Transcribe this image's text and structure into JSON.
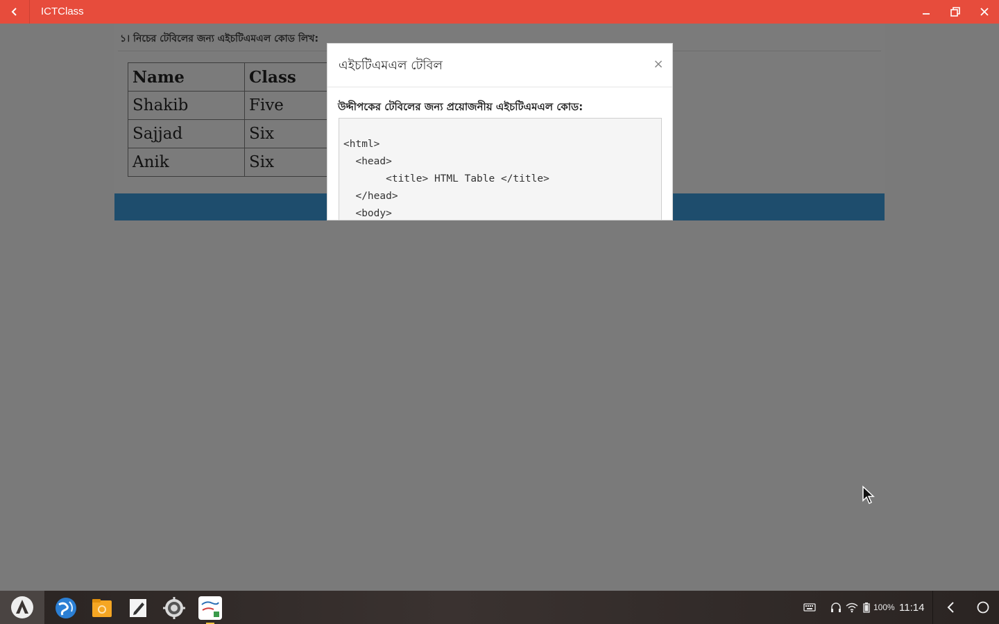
{
  "window": {
    "title": "ICTClass",
    "accent_color": "#e74c3c"
  },
  "page": {
    "question": "১। নিচের টেবিলের জন্য এইচটিএমএল কোড লিখ:",
    "table": {
      "headers": [
        "Name",
        "Class"
      ],
      "rows": [
        [
          "Shakib",
          "Five"
        ],
        [
          "Sajjad",
          "Six"
        ],
        [
          "Anik",
          "Six"
        ]
      ]
    }
  },
  "modal": {
    "title": "এইচটিএমএল টেবিল",
    "close_label": "×",
    "subtitle": "উদ্দীপকের টেবিলের জন্য প্রয়োজনীয় এইচটিএমএল কোড:",
    "code": "<html>\n  <head>\n       <title> HTML Table </title>\n  </head>\n  <body>"
  },
  "taskbar": {
    "apps": [
      "start-icon",
      "browser-icon",
      "files-icon",
      "editor-icon",
      "settings-icon",
      "ict-class-icon"
    ],
    "battery": "100%",
    "time": "11:14"
  }
}
